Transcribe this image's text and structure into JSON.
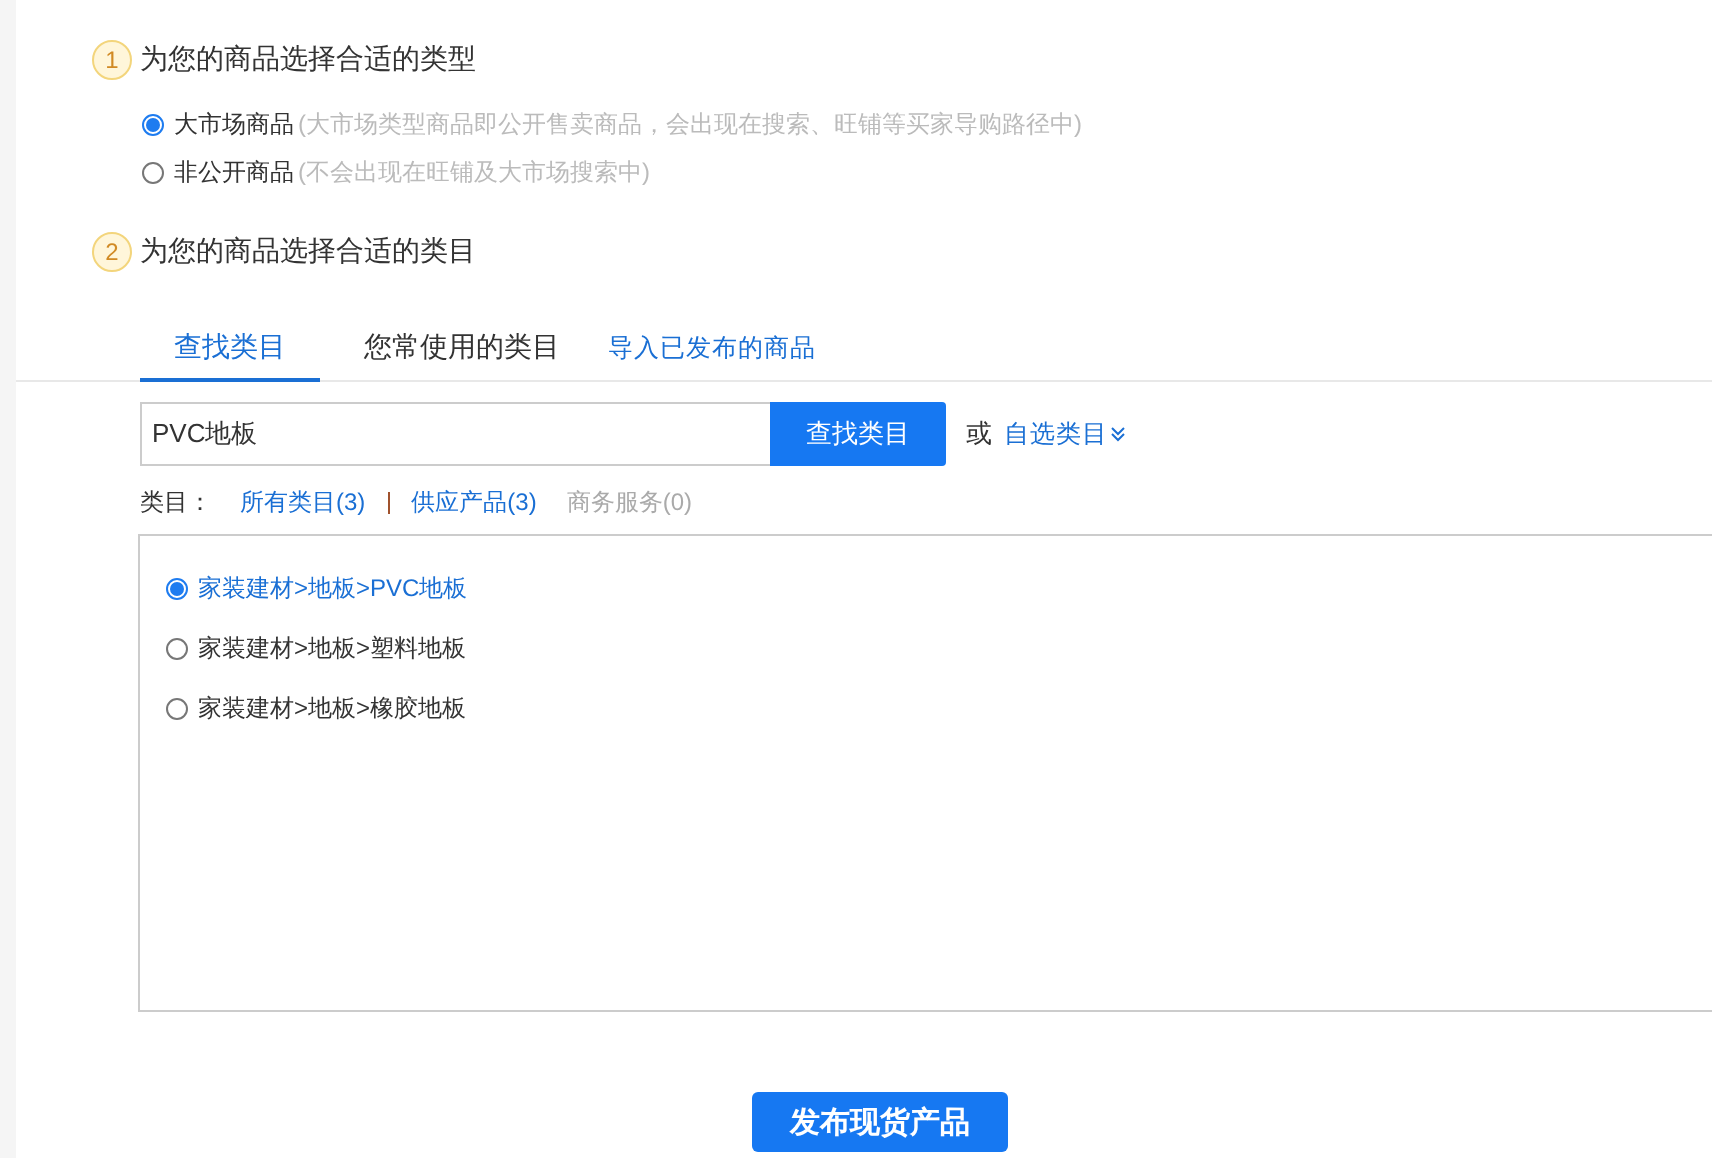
{
  "step_1": {
    "number": "1",
    "title": "为您的商品选择合适的类型",
    "options": [
      {
        "label": "大市场商品",
        "hint": "(大市场类型商品即公开售卖商品，会出现在搜索、旺铺等买家导购路径中)",
        "selected": true
      },
      {
        "label": "非公开商品",
        "hint": "(不会出现在旺铺及大市场搜索中)",
        "selected": false
      }
    ]
  },
  "step_2": {
    "number": "2",
    "title": "为您的商品选择合适的类目"
  },
  "tabs": [
    {
      "label": "查找类目",
      "kind": "tab",
      "selected": true
    },
    {
      "label": "您常使用的类目",
      "kind": "tab",
      "selected": false
    },
    {
      "label": "导入已发布的商品",
      "kind": "link"
    }
  ],
  "search": {
    "value": "PVC地板",
    "button": "查找类目",
    "or_text": "或",
    "custom_link": "自选类目"
  },
  "filter": {
    "label": "类目：",
    "items": [
      {
        "label": "所有类目(3)",
        "disabled": false
      },
      {
        "label": "供应产品(3)",
        "disabled": false
      },
      {
        "label": "商务服务(0)",
        "disabled": true
      }
    ]
  },
  "results": [
    {
      "path": "家装建材>地板>PVC地板",
      "selected": true
    },
    {
      "path": "家装建材>地板>塑料地板",
      "selected": false
    },
    {
      "path": "家装建材>地板>橡胶地板",
      "selected": false
    }
  ],
  "publish_button": "发布现货产品"
}
